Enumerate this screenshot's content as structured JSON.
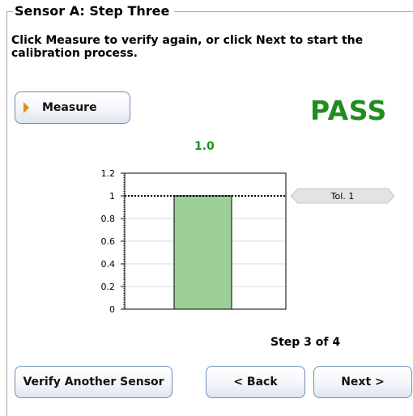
{
  "section": {
    "title": "Sensor A: Step Three"
  },
  "instructions": "Click Measure to verify again, or click Next to start the calibration process.",
  "measure_button": {
    "label": "Measure",
    "icon": "play-arrow-icon"
  },
  "result": {
    "status": "PASS",
    "color": "#1f8d1f"
  },
  "chart_data": {
    "type": "bar",
    "categories": [
      ""
    ],
    "values": [
      1.0
    ],
    "value_label": "1.0",
    "ylim": [
      0,
      1.2
    ],
    "yticks": [
      "1.2",
      "1",
      "0.8",
      "0.6",
      "0.4",
      "0.2",
      "0"
    ],
    "tolerance": {
      "value": 1,
      "label": "Tol. 1"
    },
    "grid": true,
    "bar_color": "#9ccf98"
  },
  "step_indicator": "Step 3 of 4",
  "buttons": {
    "verify_another": "Verify Another Sensor",
    "back": "< Back",
    "next": "Next >"
  }
}
